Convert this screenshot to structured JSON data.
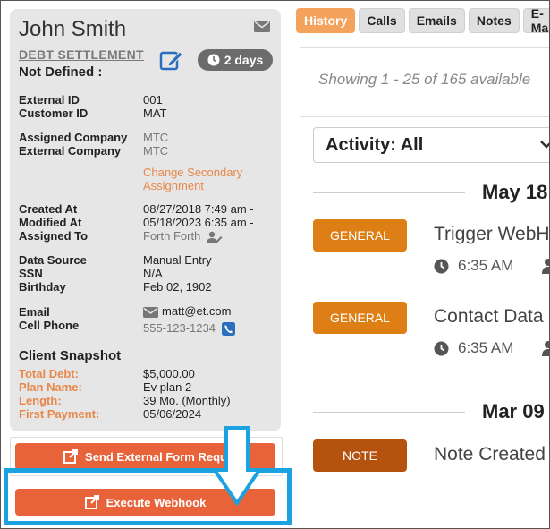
{
  "client": {
    "name": "John Smith",
    "status": "DEBT SETTLEMENT",
    "days_badge": "2 days",
    "sub_status": "Not Defined :"
  },
  "fields": {
    "external_id_label": "External ID",
    "external_id": "001",
    "customer_id_label": "Customer ID",
    "customer_id": "MAT",
    "assigned_company_label": "Assigned Company",
    "assigned_company": "MTC",
    "external_company_label": "External Company",
    "external_company": "MTC",
    "change_secondary": "Change Secondary",
    "assignment": "Assignment",
    "created_at_label": "Created At",
    "created_at": "08/27/2018 7:49 am -",
    "modified_at_label": "Modified At",
    "modified_at": "05/18/2023 6:35 am -",
    "assigned_to_label": "Assigned To",
    "assigned_to": "Forth Forth",
    "data_source_label": "Data Source",
    "data_source": "Manual Entry",
    "ssn_label": "SSN",
    "ssn": "N/A",
    "birthday_label": "Birthday",
    "birthday": "Feb 02, 1902",
    "email_label": "Email",
    "email": "matt@et.com",
    "cell_phone_label": "Cell Phone",
    "cell_phone": "555-123-1234"
  },
  "snapshot": {
    "title": "Client Snapshot",
    "total_debt_label": "Total Debt:",
    "total_debt": "$5,000.00",
    "plan_name_label": "Plan Name:",
    "plan_name": "Ev plan 2",
    "length_label": "Length:",
    "length": "39 Mo. (Monthly)",
    "first_payment_label": "First Payment:",
    "first_payment": "05/06/2024"
  },
  "buttons": {
    "send_form": "Send External Form Requ",
    "execute_webhook": "Execute Webhook"
  },
  "tabs": [
    "History",
    "Calls",
    "Emails",
    "Notes",
    "E-Mai"
  ],
  "history": {
    "showing": "Showing 1 - 25 of 165 available",
    "activity_filter": "Activity: All",
    "groups": [
      {
        "date": "May 18"
      },
      {
        "date": "Mar 09"
      }
    ],
    "entries": [
      {
        "badge": "GENERAL",
        "title": "Trigger WebH",
        "time": "6:35 AM"
      },
      {
        "badge": "GENERAL",
        "title": "Contact Data",
        "time": "6:35 AM"
      },
      {
        "badge": "NOTE",
        "title": "Note Created"
      }
    ]
  },
  "colors": {
    "accent_orange": "#e8623a",
    "tab_active": "#f5a25d",
    "badge_general": "#de7f16",
    "badge_note": "#b5520e",
    "highlight_blue": "#1aa3e0"
  }
}
